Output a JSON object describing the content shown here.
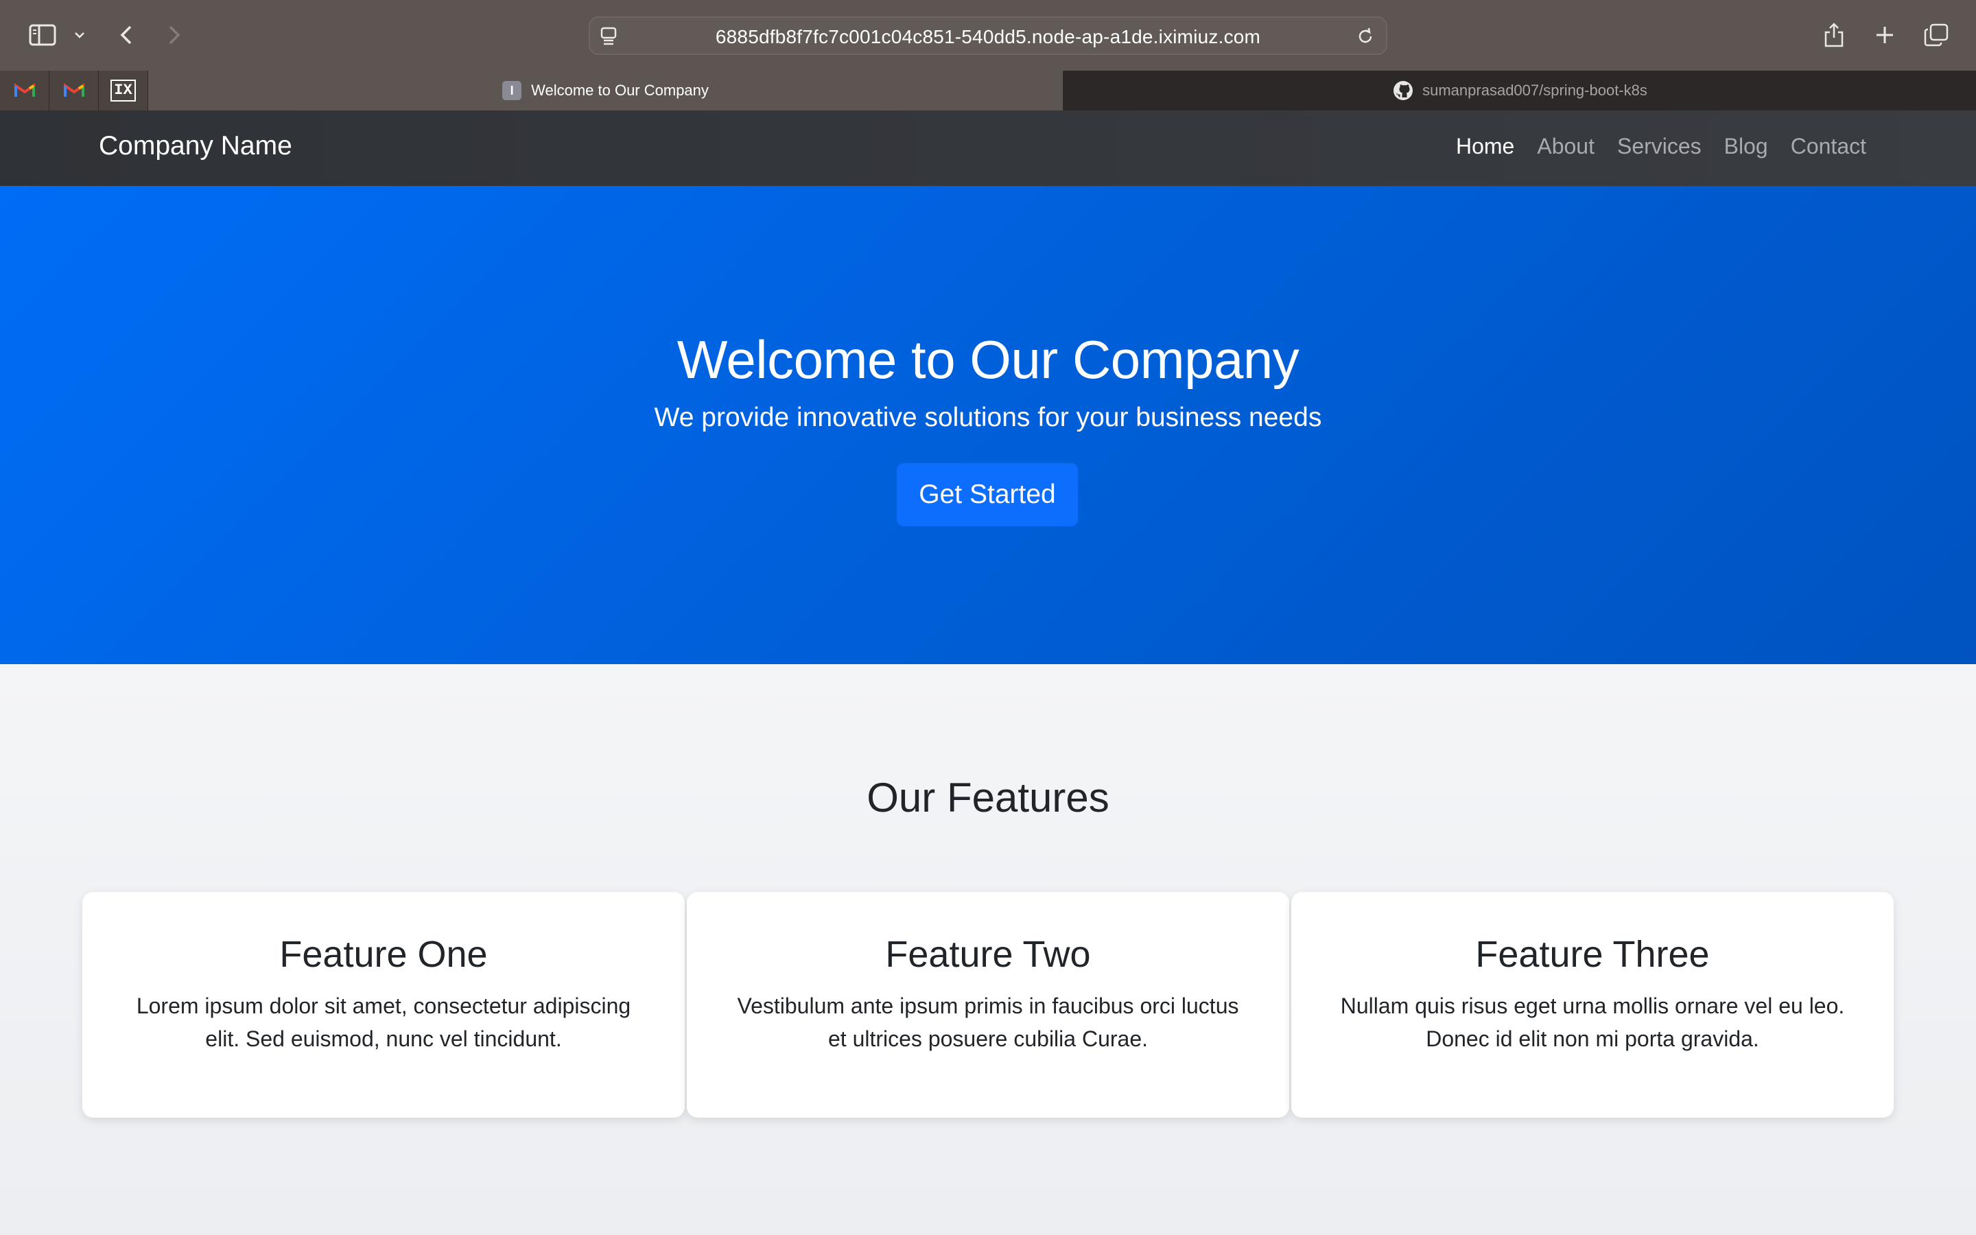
{
  "browser": {
    "url": "6885dfb8f7fc7c001c04c851-540dd5.node-ap-a1de.iximiuz.com",
    "tabs": [
      {
        "title": "Welcome to Our Company",
        "active": true,
        "favicon_letter": "I"
      },
      {
        "title": "sumanprasad007/spring-boot-k8s",
        "active": false,
        "favicon": "github-icon"
      }
    ],
    "pinned_tabs": [
      "gmail-icon",
      "gmail-icon",
      "iximiuz-icon"
    ],
    "pinned_label": "IX"
  },
  "navbar": {
    "brand": "Company Name",
    "links": [
      {
        "label": "Home",
        "active": true
      },
      {
        "label": "About",
        "active": false
      },
      {
        "label": "Services",
        "active": false
      },
      {
        "label": "Blog",
        "active": false
      },
      {
        "label": "Contact",
        "active": false
      }
    ]
  },
  "hero": {
    "title": "Welcome to Our Company",
    "subtitle": "We provide innovative solutions for your business needs",
    "cta_label": "Get Started"
  },
  "features": {
    "heading": "Our Features",
    "items": [
      {
        "title": "Feature One",
        "text": "Lorem ipsum dolor sit amet, consectetur adipiscing elit. Sed euismod, nunc vel tincidunt."
      },
      {
        "title": "Feature Two",
        "text": "Vestibulum ante ipsum primis in faucibus orci luctus et ultrices posuere cubilia Curae."
      },
      {
        "title": "Feature Three",
        "text": "Nullam quis risus eget urna mollis ornare vel eu leo. Donec id elit non mi porta gravida."
      }
    ]
  },
  "colors": {
    "chrome": "#5d5551",
    "navbar": "#343a40",
    "hero": "#0066ee",
    "button": "#0d6efd"
  }
}
